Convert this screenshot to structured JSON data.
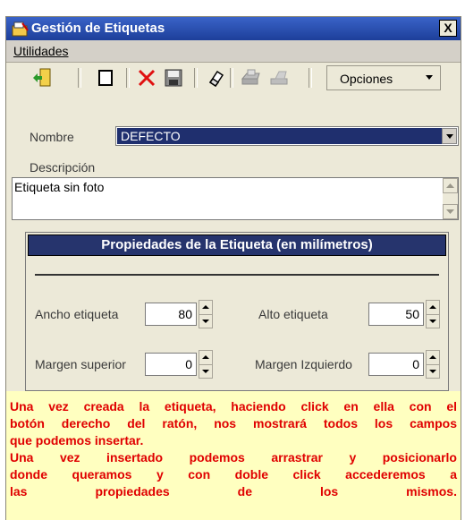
{
  "window": {
    "title": "Gestión de Etiquetas",
    "close_label": "X"
  },
  "menu": {
    "items": [
      {
        "label": "Utilidades"
      }
    ]
  },
  "toolbar": {
    "options_label": "Opciones",
    "icons": [
      "exit-icon",
      "new-icon",
      "delete-icon",
      "save-icon",
      "eraser-icon",
      "print-icon",
      "print-disabled-icon"
    ]
  },
  "form": {
    "nombre_label": "Nombre",
    "nombre_value": "DEFECTO",
    "descripcion_label": "Descripción",
    "descripcion_value": "Etiqueta sin foto"
  },
  "properties": {
    "header": "Propiedades de la Etiqueta (en milímetros)",
    "ancho_label": "Ancho etiqueta",
    "ancho_value": "80",
    "alto_label": "Alto etiqueta",
    "alto_value": "50",
    "margen_sup_label": "Margen superior",
    "margen_sup_value": "0",
    "margen_izq_label": "Margen Izquierdo",
    "margen_izq_value": "0"
  },
  "note": {
    "lines": [
      "Una vez creada la etiqueta, haciendo click en ella con el",
      "botón derecho del ratón, nos mostrará todos los campos",
      "que podemos insertar.",
      "Una vez insertado podemos arrastrar y posicionarlo",
      "donde queramos y con doble click accederemos a",
      "las propiedades de los mismos."
    ]
  },
  "colors": {
    "title_bar": "#1d3f9a",
    "selected_value_bg": "#1f2f6e",
    "note_text": "#e00000",
    "note_bg": "#ffffc0"
  }
}
